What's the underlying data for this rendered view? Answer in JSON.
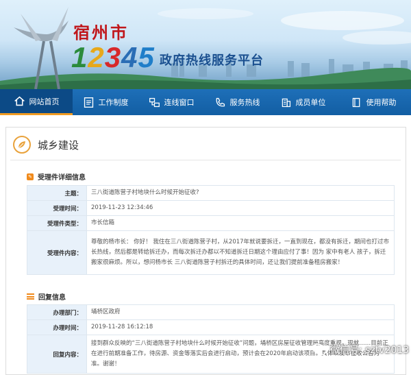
{
  "header": {
    "site_name": "宿州市",
    "hotline_digits": [
      "1",
      "2",
      "3",
      "4",
      "5"
    ],
    "platform_name": "政府热线服务平台"
  },
  "nav": [
    {
      "label": "网站首页",
      "icon": "home-icon",
      "active": true
    },
    {
      "label": "工作制度",
      "icon": "document-list-icon",
      "active": false
    },
    {
      "label": "连线窗口",
      "icon": "link-window-icon",
      "active": false
    },
    {
      "label": "服务热线",
      "icon": "phone-icon",
      "active": false
    },
    {
      "label": "成员单位",
      "icon": "building-icon",
      "active": false
    },
    {
      "label": "使用帮助",
      "icon": "help-book-icon",
      "active": false
    }
  ],
  "page": {
    "title": "城乡建设"
  },
  "request_section": {
    "heading": "受理件详细信息",
    "rows": [
      {
        "label": "主题：",
        "value": "三八街道陈营子村地块什么时候开始征收?"
      },
      {
        "label": "受理时间：",
        "value": "2019-11-23 12:34:46"
      },
      {
        "label": "受理件类型：",
        "value": "市长信箱"
      },
      {
        "label": "受理件内容：",
        "value": "尊敬的杨市长： 你好！ 我住在三八街道陈营子村，从2017年就说要拆迁，一直到现在，都没有拆迁，期间也打过市长热线，然后都是转给拆迁办，而每次拆迁办都以不知道拆迁日期这个理由应付了事！因为 家中有老人 孩子，拆迁搬家很麻烦。所以，想问杨市长 三八街道陈营子村拆迁的具体时间，还让我们提前准备租房搬家！"
      }
    ]
  },
  "reply_section": {
    "heading": "回复信息",
    "rows": [
      {
        "label": "办理部门：",
        "value": "埇桥区政府"
      },
      {
        "label": "办理时间：",
        "value": "2019-11-28 16:12:18"
      },
      {
        "label": "回复内容：",
        "value": "接到群众反映的“三八街道陈营子村地块什么时候开始征收”问题，埇桥区房屋征收管理局高度重视，现就……目前正在进行前期准备工作，待房源、资金等落实后会进行启动，预计会在2020年启动该项目。具体以发布征收公告为准。谢谢！"
      }
    ]
  },
  "watermark": {
    "text": "微信号: sztv2013"
  }
}
